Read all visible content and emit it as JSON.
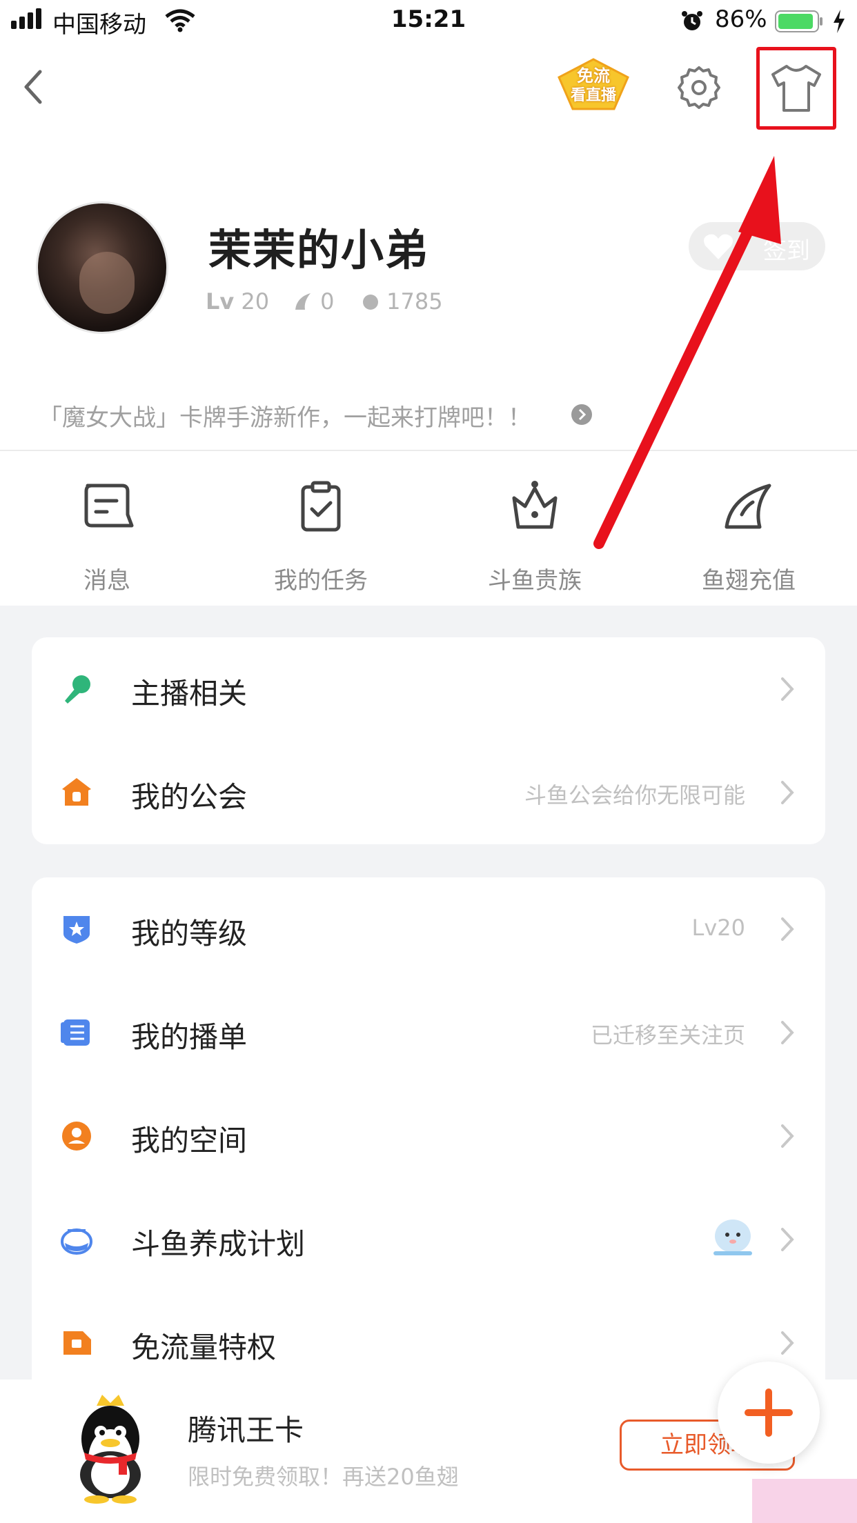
{
  "status_bar": {
    "carrier": "中国移动",
    "time": "15:21",
    "battery": "86%",
    "icons": [
      "signal-icon",
      "wifi-icon",
      "alarm-icon",
      "battery-icon",
      "charging-icon"
    ]
  },
  "header": {
    "back_icon": "chevron-left-icon",
    "promo_badge_line1": "免流",
    "promo_badge_line2": "看直播",
    "settings_icon": "gear-icon",
    "skin_icon": "tshirt-icon"
  },
  "profile": {
    "username": "茉茉的小弟",
    "level_prefix": "Lv",
    "level": "20",
    "fins": "0",
    "balls": "1785",
    "checkin_label": "签到",
    "announcement": "「魔女大战」卡牌手游新作，一起来打牌吧！！"
  },
  "quick_actions": [
    {
      "label": "消息",
      "icon": "message-icon"
    },
    {
      "label": "我的任务",
      "icon": "task-clipboard-icon"
    },
    {
      "label": "斗鱼贵族",
      "icon": "crown-icon"
    },
    {
      "label": "鱼翅充值",
      "icon": "fin-icon"
    }
  ],
  "menu_group_1": [
    {
      "label": "主播相关",
      "hint": "",
      "icon": "microphone-icon",
      "color": "#2fb57a"
    },
    {
      "label": "我的公会",
      "hint": "斗鱼公会给你无限可能",
      "icon": "guild-house-icon",
      "color": "#f2801f"
    }
  ],
  "menu_group_2": [
    {
      "label": "我的等级",
      "hint": "Lv20",
      "icon": "star-shield-icon",
      "color": "#4f86ec"
    },
    {
      "label": "我的播单",
      "hint": "已迁移至关注页",
      "icon": "playlist-icon",
      "color": "#4f86ec"
    },
    {
      "label": "我的空间",
      "hint": "",
      "icon": "user-circle-icon",
      "color": "#f2801f"
    },
    {
      "label": "斗鱼养成计划",
      "hint": "",
      "icon": "fishbowl-icon",
      "color": "#4f86ec"
    },
    {
      "label": "免流量特权",
      "hint": "",
      "icon": "data-tag-icon",
      "color": "#f2801f"
    }
  ],
  "ad": {
    "title": "腾讯王卡",
    "subtitle": "限时免费领取！再送20鱼翅",
    "button": "立即领取"
  },
  "fab_icon": "plus-icon",
  "colors": {
    "accent": "#f2801f",
    "annotation_red": "#e8111c"
  }
}
